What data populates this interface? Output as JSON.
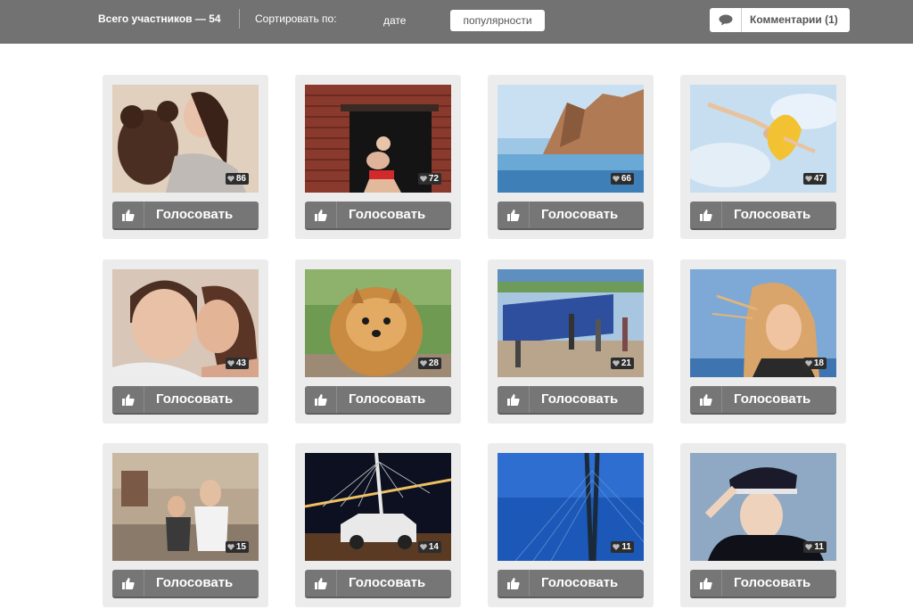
{
  "header": {
    "total_participants": "Всего участников — 54",
    "sort_label": "Сортировать по:",
    "sort_options": [
      "дате",
      "популярности"
    ],
    "sort_selected": "популярности",
    "comments_label": "Комментарии (1)"
  },
  "vote_label": "Голосовать",
  "entries": [
    {
      "likes": "86",
      "photo": "girl-with-teddy-bear"
    },
    {
      "likes": "72",
      "photo": "woman-in-brick-window"
    },
    {
      "likes": "66",
      "photo": "frozen-lake-rocks"
    },
    {
      "likes": "47",
      "photo": "aerial-dancer-sky"
    },
    {
      "likes": "43",
      "photo": "couple-portrait"
    },
    {
      "likes": "28",
      "photo": "pomeranian-dog"
    },
    {
      "likes": "21",
      "photo": "vladivostok-sign"
    },
    {
      "likes": "18",
      "photo": "woman-sea-wind"
    },
    {
      "likes": "15",
      "photo": "mother-and-child"
    },
    {
      "likes": "14",
      "photo": "car-at-night-bridge"
    },
    {
      "likes": "11",
      "photo": "bridge-pylon-blue"
    },
    {
      "likes": "11",
      "photo": "man-in-police-cap"
    }
  ],
  "colors": {
    "header_bg": "#727272",
    "card_bg": "#ececec",
    "vote_button": "#767676",
    "likes_badge": "#2d2d2d"
  }
}
